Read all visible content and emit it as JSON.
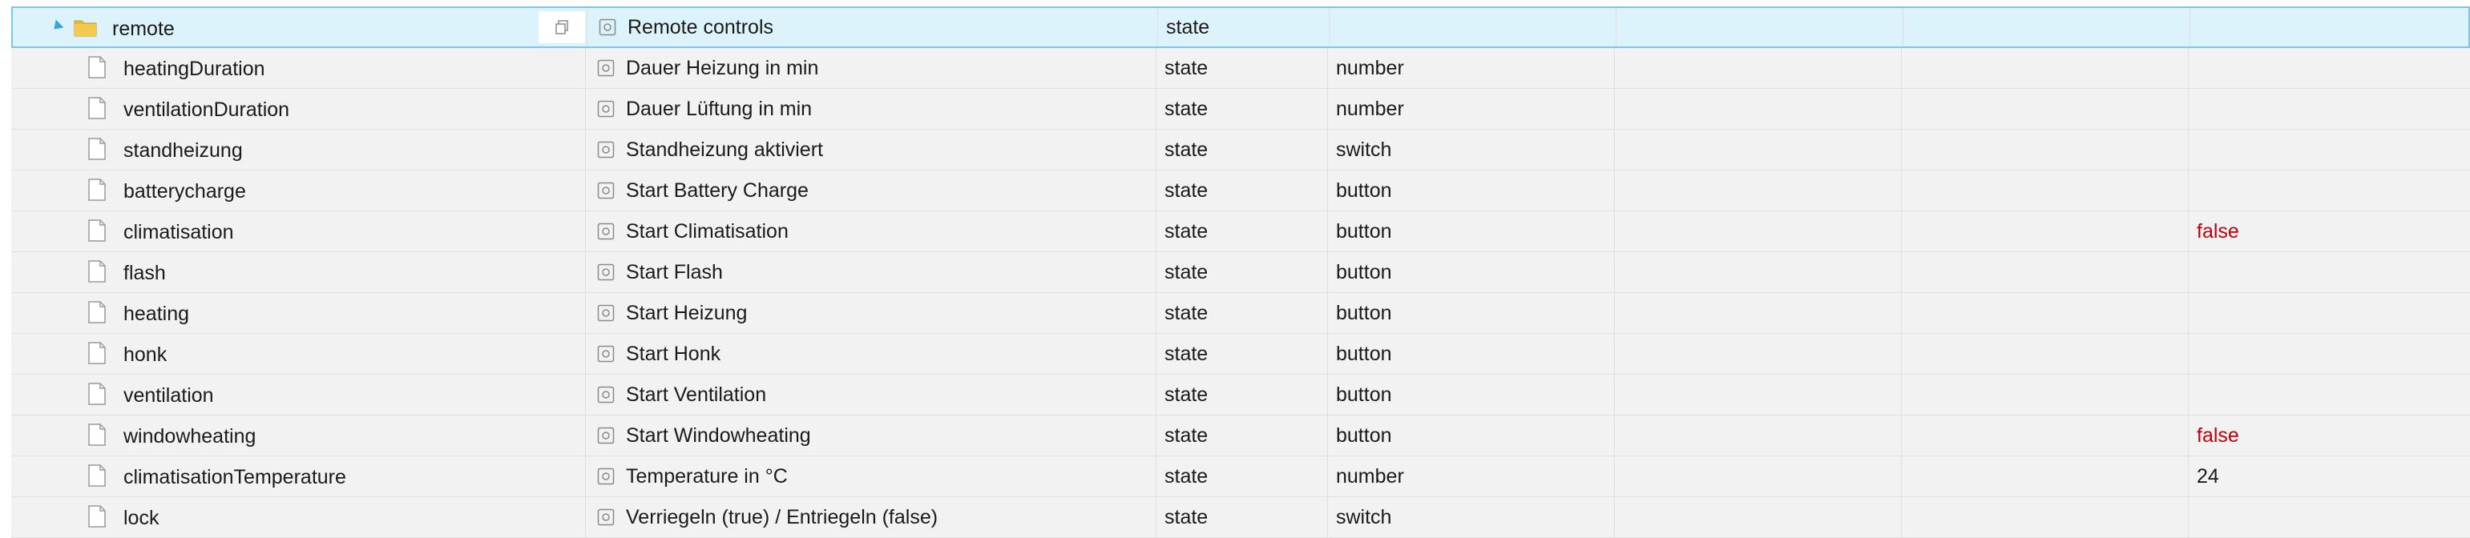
{
  "rows": [
    {
      "id": "remote",
      "name": "Remote controls",
      "type": "state",
      "role": "",
      "value": "",
      "folder": true
    },
    {
      "id": "heatingDuration",
      "name": "Dauer Heizung in min",
      "type": "state",
      "role": "number",
      "value": ""
    },
    {
      "id": "ventilationDuration",
      "name": "Dauer Lüftung in min",
      "type": "state",
      "role": "number",
      "value": ""
    },
    {
      "id": "standheizung",
      "name": "Standheizung aktiviert",
      "type": "state",
      "role": "switch",
      "value": ""
    },
    {
      "id": "batterycharge",
      "name": "Start Battery Charge",
      "type": "state",
      "role": "button",
      "value": ""
    },
    {
      "id": "climatisation",
      "name": "Start Climatisation",
      "type": "state",
      "role": "button",
      "value": "false"
    },
    {
      "id": "flash",
      "name": "Start Flash",
      "type": "state",
      "role": "button",
      "value": ""
    },
    {
      "id": "heating",
      "name": "Start Heizung",
      "type": "state",
      "role": "button",
      "value": ""
    },
    {
      "id": "honk",
      "name": "Start Honk",
      "type": "state",
      "role": "button",
      "value": ""
    },
    {
      "id": "ventilation",
      "name": "Start Ventilation",
      "type": "state",
      "role": "button",
      "value": ""
    },
    {
      "id": "windowheating",
      "name": "Start Windowheating",
      "type": "state",
      "role": "button",
      "value": "false"
    },
    {
      "id": "climatisationTemperature",
      "name": "Temperature in °C",
      "type": "state",
      "role": "number",
      "value": "24"
    },
    {
      "id": "lock",
      "name": "Verriegeln (true) / Entriegeln (false)",
      "type": "state",
      "role": "switch",
      "value": ""
    }
  ],
  "icons": {
    "expander": "expand-triangle-icon",
    "folder": "folder-icon",
    "file": "file-icon",
    "copy": "copy-icon",
    "object": "state-object-icon"
  },
  "colors": {
    "selected_bg": "#dcf3fb",
    "selected_border": "#7fc5e6",
    "row_bg": "#f2f2f2",
    "false_value": "#c0000a",
    "expander": "#3aa4d8",
    "folder": "#e8b93a"
  }
}
